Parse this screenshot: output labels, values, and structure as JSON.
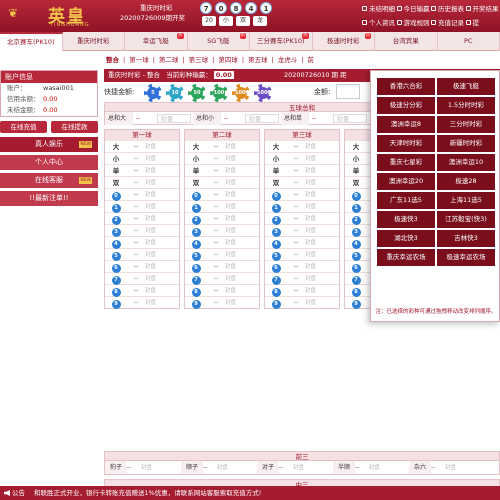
{
  "header": {
    "logo_cn": "英皇",
    "logo_en": "YINGHUANG",
    "lottery_name": "重庆时时彩",
    "draw_line": "20200726009期开奖",
    "balls": [
      "7",
      "0",
      "8",
      "4",
      "1"
    ],
    "sums": [
      "20",
      "小",
      "双",
      "龙"
    ],
    "user_menu": [
      "未结明细",
      "今日输赢",
      "历史报表",
      "开奖结果",
      "个人资讯",
      "游戏规则",
      "充值记录",
      "提"
    ]
  },
  "nav": [
    {
      "label": "北京赛车(PK10)",
      "active": true,
      "badge": ""
    },
    {
      "label": "重庆时时彩",
      "active": false,
      "badge": ""
    },
    {
      "label": "幸运飞艇",
      "active": false,
      "badge": "热"
    },
    {
      "label": "SG飞艇",
      "active": false,
      "badge": "新"
    },
    {
      "label": "三分赛车(PK10)",
      "active": false,
      "badge": "热"
    },
    {
      "label": "极速时时彩",
      "active": false,
      "badge": "热"
    },
    {
      "label": "台湾宾果",
      "active": false,
      "badge": ""
    },
    {
      "label": "PC",
      "active": false,
      "badge": ""
    }
  ],
  "subnav": [
    "整合",
    "第一球",
    "第二球",
    "第三球",
    "第四球",
    "第五球",
    "龙虎斗",
    "前"
  ],
  "account": {
    "title": "账户信息",
    "rows": [
      {
        "k": "账户：",
        "v": "wasai001",
        "red": false
      },
      {
        "k": "信用余额：",
        "v": "0.00",
        "red": true
      },
      {
        "k": "未结金额：",
        "v": "0.00",
        "red": true
      }
    ],
    "btn_deposit": "在线充值",
    "btn_withdraw": "在线提款"
  },
  "sidebar_links": [
    {
      "label": "真人娱乐",
      "new": "NEW"
    },
    {
      "label": "个人中心",
      "new": ""
    },
    {
      "label": "在线客服",
      "new": "NEW"
    },
    {
      "label": "!!最新注单!!",
      "new": ""
    }
  ],
  "infobar": {
    "text": "重庆时时彩 - 整合",
    "current_label": "当前彩种输赢：",
    "current_value": "0.00",
    "period": "20200726010 期 距"
  },
  "quickbet": {
    "label": "快捷金额:",
    "chips": [
      {
        "value": "5",
        "color": "#2f6fd6"
      },
      {
        "value": "10",
        "color": "#2ea6c9"
      },
      {
        "value": "50",
        "color": "#2aa55a"
      },
      {
        "value": "100",
        "color": "#2aa55a"
      },
      {
        "value": "1000",
        "color": "#e08a20"
      },
      {
        "value": "5000",
        "color": "#6b4bc6"
      }
    ],
    "amount_label": "金额:"
  },
  "total_section": {
    "title": "五球总和",
    "items": [
      {
        "k": "总和大",
        "o": "--",
        "p": "封盘"
      },
      {
        "k": "总和小",
        "o": "--",
        "p": "封盘"
      },
      {
        "k": "总和单",
        "o": "--",
        "p": "封盘"
      }
    ]
  },
  "ball_columns": [
    {
      "title": "第一球"
    },
    {
      "title": "第二球"
    },
    {
      "title": "第三球"
    },
    {
      "title": "第四球"
    }
  ],
  "ball_rows": [
    {
      "k": "大",
      "o": "--",
      "p": "封盘"
    },
    {
      "k": "小",
      "o": "--",
      "p": "封盘"
    },
    {
      "k": "单",
      "o": "--",
      "p": "封盘"
    },
    {
      "k": "双",
      "o": "--",
      "p": "封盘"
    }
  ],
  "number_rows": [
    "0",
    "1",
    "2",
    "3",
    "4",
    "5",
    "6",
    "7",
    "8",
    "9"
  ],
  "three_sections": [
    {
      "title": "前三",
      "items": [
        "豹子",
        "顺子",
        "对子",
        "半顺",
        "杂六"
      ]
    },
    {
      "title": "中三",
      "items": [
        "豹子",
        "顺子",
        "对子",
        "半顺",
        "杂六"
      ]
    },
    {
      "title": "后三",
      "items": []
    }
  ],
  "closed_text": "封盘",
  "dash_text": "--",
  "dropdown": {
    "items": [
      "香港六合彩",
      "极速飞艇",
      "极速分分彩",
      "1.5分时时彩",
      "澳洲幸运8",
      "三分时时彩",
      "天津时时彩",
      "新疆时时彩",
      "重庆七星彩",
      "澳洲幸运10",
      "澳洲幸运20",
      "极速28",
      "广东11选5",
      "上海11选5",
      "极速快3",
      "江苏骰宝(快3)",
      "湖北快3",
      "吉林快3",
      "重庆幸运农场",
      "极速幸运农场"
    ],
    "note": "注：已选择的彩种可通过拖拽移动改变排列顺序。"
  },
  "footer": {
    "label": "公告",
    "text": "和联胜正式开业，银行卡转账充值赠送1%优惠，请联系网站客服索取充值方式!"
  }
}
